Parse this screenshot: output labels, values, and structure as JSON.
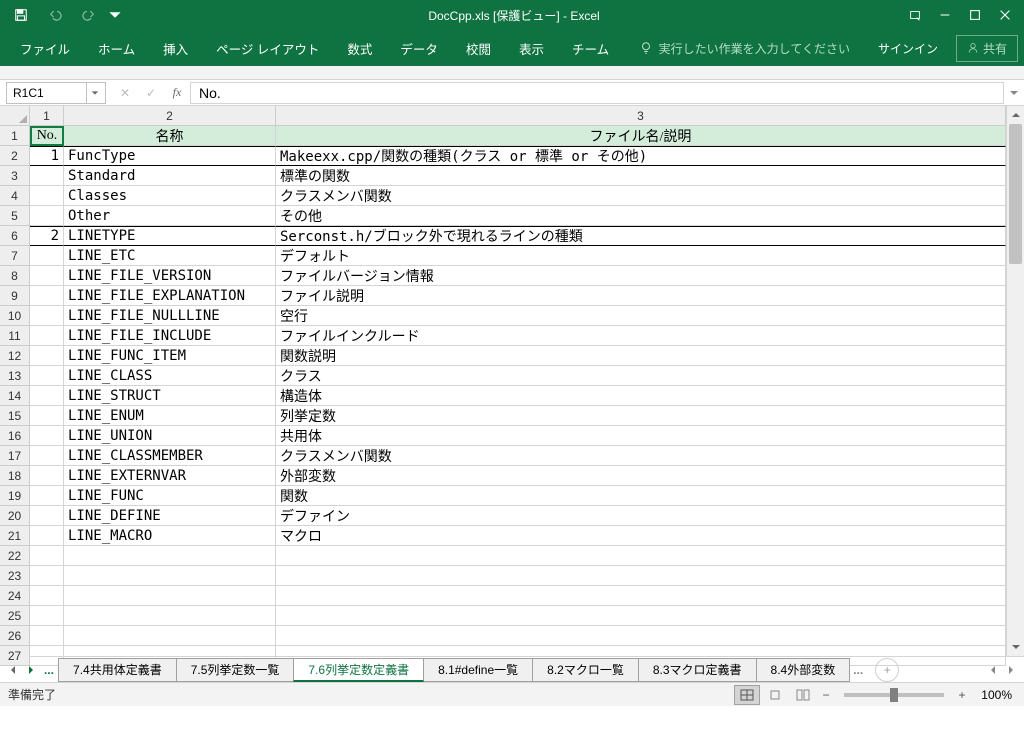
{
  "title": "DocCpp.xls [保護ビュー] - Excel",
  "ribbon": {
    "tabs": [
      "ファイル",
      "ホーム",
      "挿入",
      "ページ レイアウト",
      "数式",
      "データ",
      "校閲",
      "表示",
      "チーム"
    ],
    "tell_me": "実行したい作業を入力してください",
    "signin": "サインイン",
    "share": "共有"
  },
  "name_box": "R1C1",
  "formula": "No.",
  "col_headers": [
    "1",
    "2",
    "3"
  ],
  "row_headers": [
    "1",
    "2",
    "3",
    "4",
    "5",
    "6",
    "7",
    "8",
    "9",
    "10",
    "11",
    "12",
    "13",
    "14",
    "15",
    "16",
    "17",
    "18",
    "19",
    "20",
    "21",
    "22",
    "23",
    "24",
    "25",
    "26",
    "27"
  ],
  "header_row": {
    "no": "No.",
    "name": "名称",
    "desc": "ファイル名/説明"
  },
  "rows": [
    {
      "no": "1",
      "name": "FuncType",
      "desc": "Makeexx.cpp/関数の種類(クラス or 標準 or その他)",
      "group": true
    },
    {
      "no": "",
      "name": "Standard",
      "desc": "標準の関数"
    },
    {
      "no": "",
      "name": "Classes",
      "desc": "クラスメンバ関数"
    },
    {
      "no": "",
      "name": "Other",
      "desc": "その他"
    },
    {
      "no": "2",
      "name": "LINETYPE",
      "desc": "Serconst.h/ブロック外で現れるラインの種類",
      "group": true
    },
    {
      "no": "",
      "name": "LINE_ETC",
      "desc": "デフォルト"
    },
    {
      "no": "",
      "name": "LINE_FILE_VERSION",
      "desc": "ファイルバージョン情報"
    },
    {
      "no": "",
      "name": "LINE_FILE_EXPLANATION",
      "desc": "ファイル説明"
    },
    {
      "no": "",
      "name": "LINE_FILE_NULLLINE",
      "desc": "空行"
    },
    {
      "no": "",
      "name": "LINE_FILE_INCLUDE",
      "desc": "ファイルインクルード"
    },
    {
      "no": "",
      "name": "LINE_FUNC_ITEM",
      "desc": "関数説明"
    },
    {
      "no": "",
      "name": "LINE_CLASS",
      "desc": "クラス"
    },
    {
      "no": "",
      "name": "LINE_STRUCT",
      "desc": "構造体"
    },
    {
      "no": "",
      "name": "LINE_ENUM",
      "desc": "列挙定数"
    },
    {
      "no": "",
      "name": "LINE_UNION",
      "desc": "共用体"
    },
    {
      "no": "",
      "name": "LINE_CLASSMEMBER",
      "desc": "クラスメンバ関数"
    },
    {
      "no": "",
      "name": "LINE_EXTERNVAR",
      "desc": "外部変数"
    },
    {
      "no": "",
      "name": "LINE_FUNC",
      "desc": "関数"
    },
    {
      "no": "",
      "name": "LINE_DEFINE",
      "desc": "デファイン"
    },
    {
      "no": "",
      "name": "LINE_MACRO",
      "desc": "マクロ"
    },
    {
      "no": "",
      "name": "",
      "desc": ""
    },
    {
      "no": "",
      "name": "",
      "desc": ""
    },
    {
      "no": "",
      "name": "",
      "desc": ""
    },
    {
      "no": "",
      "name": "",
      "desc": ""
    },
    {
      "no": "",
      "name": "",
      "desc": ""
    },
    {
      "no": "",
      "name": "",
      "desc": ""
    }
  ],
  "sheet_tabs": {
    "list": [
      "7.4共用体定義書",
      "7.5列挙定数一覧",
      "7.6列挙定数定義書",
      "8.1#define一覧",
      "8.2マクロ一覧",
      "8.3マクロ定義書",
      "8.4外部変数"
    ],
    "active_index": 2,
    "overflow": "..."
  },
  "status": {
    "ready": "準備完了",
    "zoom": "100%"
  }
}
